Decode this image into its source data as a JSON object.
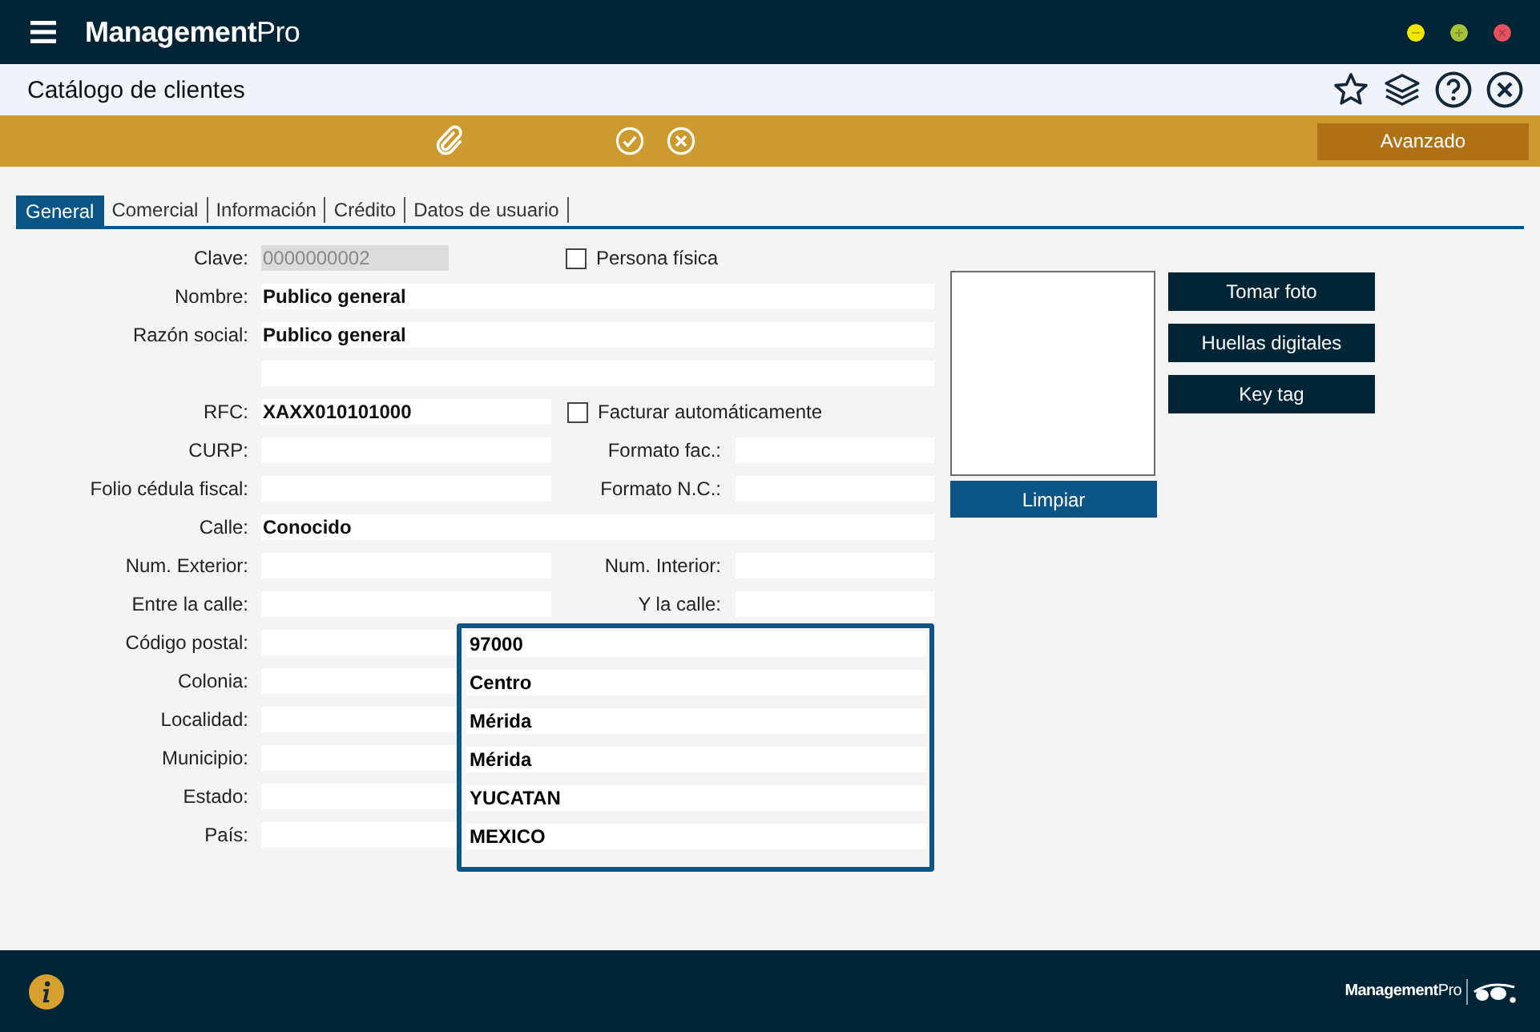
{
  "app": {
    "name": "**Management**Pro",
    "window_controls": [
      {
        "kind": "minimize",
        "color": "#f2e600"
      },
      {
        "kind": "maximize",
        "color": "#a6c23a"
      },
      {
        "kind": "close",
        "color": "#e6505f"
      }
    ]
  },
  "page": {
    "title": "Catálogo de clientes"
  },
  "toolbar": {
    "advanced_button": "Avanzado"
  },
  "tabs": [
    {
      "label": "General",
      "selected": true
    },
    {
      "label": "Comercial",
      "selected": false
    },
    {
      "label": "Información",
      "selected": false
    },
    {
      "label": "Crédito",
      "selected": false
    },
    {
      "label": "Datos de usuario",
      "selected": false
    }
  ],
  "fields": [
    {
      "label": "Clave:",
      "value": "0000000002",
      "kind": "readonly",
      "right": {
        "kind": "checkbox",
        "label": "Persona física",
        "checked": false
      }
    },
    {
      "label": "Nombre:",
      "value": "Publico general",
      "kind": "text"
    },
    {
      "label": "Razón social:",
      "value": "Publico general",
      "kind": "text"
    },
    {
      "kind": "text"
    },
    {
      "label": "RFC:",
      "value": "XAXX010101000",
      "kind": "text",
      "right": {
        "kind": "checkbox",
        "label": "Facturar automáticamente",
        "checked": false
      }
    },
    {
      "label": "CURP:",
      "kind": "text",
      "right": {
        "kind": "field",
        "label": "Formato fac.:"
      }
    },
    {
      "label": "Folio cédula fiscal:",
      "kind": "text",
      "right": {
        "kind": "field",
        "label": "Formato N.C.:"
      }
    },
    {
      "label": "Calle:",
      "value": "Conocido",
      "kind": "text"
    },
    {
      "label": "Num. Exterior:",
      "kind": "text",
      "right": {
        "kind": "field",
        "label": "Num. Interior:"
      }
    },
    {
      "label": "Entre la calle:",
      "kind": "text",
      "right": {
        "kind": "field",
        "label": "Y la calle:"
      }
    },
    {
      "label": "Código postal:",
      "kind": "text"
    },
    {
      "label": "Colonia:",
      "kind": "text"
    },
    {
      "label": "Localidad:",
      "kind": "text"
    },
    {
      "label": "Municipio:",
      "kind": "text"
    },
    {
      "label": "Estado:",
      "kind": "text"
    },
    {
      "label": "País:",
      "kind": "text"
    }
  ],
  "address_popup": [
    "97000",
    "Centro",
    "Mérida",
    "Mérida",
    "YUCATAN",
    "MEXICO"
  ],
  "photo": {
    "clear_button": "Limpiar"
  },
  "side_buttons": [
    "Tomar foto",
    "Huellas digitales",
    "Key tag"
  ],
  "footer": {
    "brand": "**Management**Pro"
  }
}
